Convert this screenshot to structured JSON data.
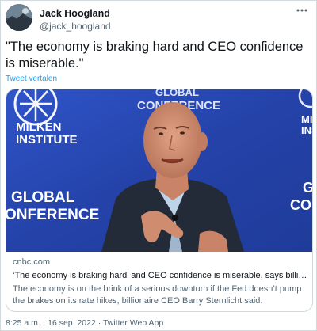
{
  "author": {
    "name": "Jack Hoogland",
    "handle": "@jack_hoogland"
  },
  "tweet": {
    "text": "\"The economy is braking hard and CEO confidence is miserable.\"",
    "translate_label": "Tweet vertalen"
  },
  "card": {
    "image_text": {
      "left_brand_1": "MILKEN",
      "left_brand_2": "INSTITUTE",
      "left_event_1": "GLOBAL",
      "left_event_2": "ONFERENCE",
      "top_center": "GLOBAL",
      "top_center_2": "CONFERENCE",
      "right_brand_1": "MILKEN",
      "right_brand_2": "INSTITU",
      "right_event_1": "G",
      "right_event_2": "CON"
    },
    "domain": "cnbc.com",
    "title": "‘The economy is braking hard’ and CEO confidence is miserable, says billionair...",
    "description": "The economy is on the brink of a serious downturn if the Fed doesn’t pump the brakes on its rate hikes, billionaire CEO Barry Sternlicht said."
  },
  "footer": {
    "meta": "8:25 a.m. · 16 sep. 2022 · Twitter Web App"
  },
  "colors": {
    "link": "#1d9bf0",
    "secondary_text": "#536471",
    "backdrop_blue": "#2a4bbd"
  },
  "icons": {
    "more": "more-horizontal-icon"
  }
}
